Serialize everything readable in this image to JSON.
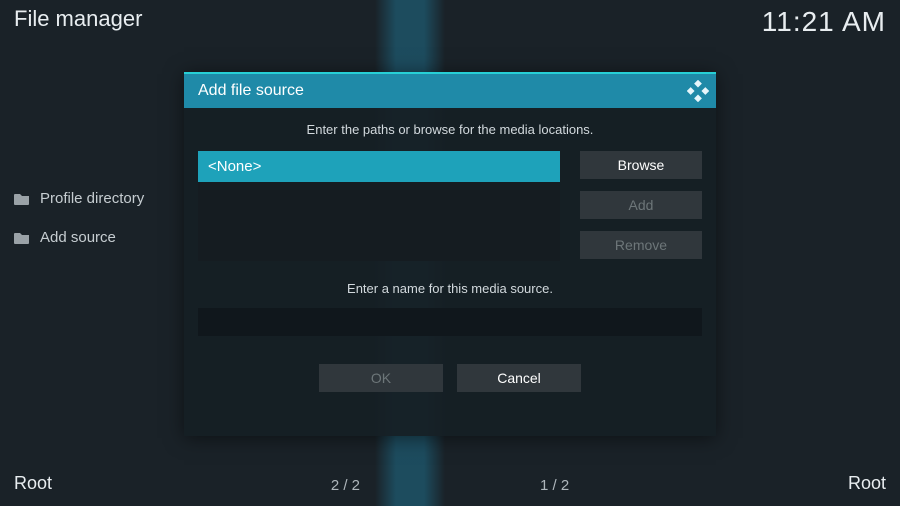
{
  "header": {
    "title": "File manager",
    "clock": "11:21 AM"
  },
  "sidebar": {
    "items": [
      {
        "label": "Profile directory"
      },
      {
        "label": "Add source"
      }
    ]
  },
  "dialog": {
    "title": "Add file source",
    "instruction": "Enter the paths or browse for the media locations.",
    "path_selected": "<None>",
    "browse_label": "Browse",
    "add_label": "Add",
    "remove_label": "Remove",
    "name_instruction": "Enter a name for this media source.",
    "name_value": "",
    "ok_label": "OK",
    "cancel_label": "Cancel"
  },
  "footer": {
    "left_label": "Root",
    "right_label": "Root",
    "counter_left": "2 / 2",
    "counter_right": "1 / 2"
  }
}
